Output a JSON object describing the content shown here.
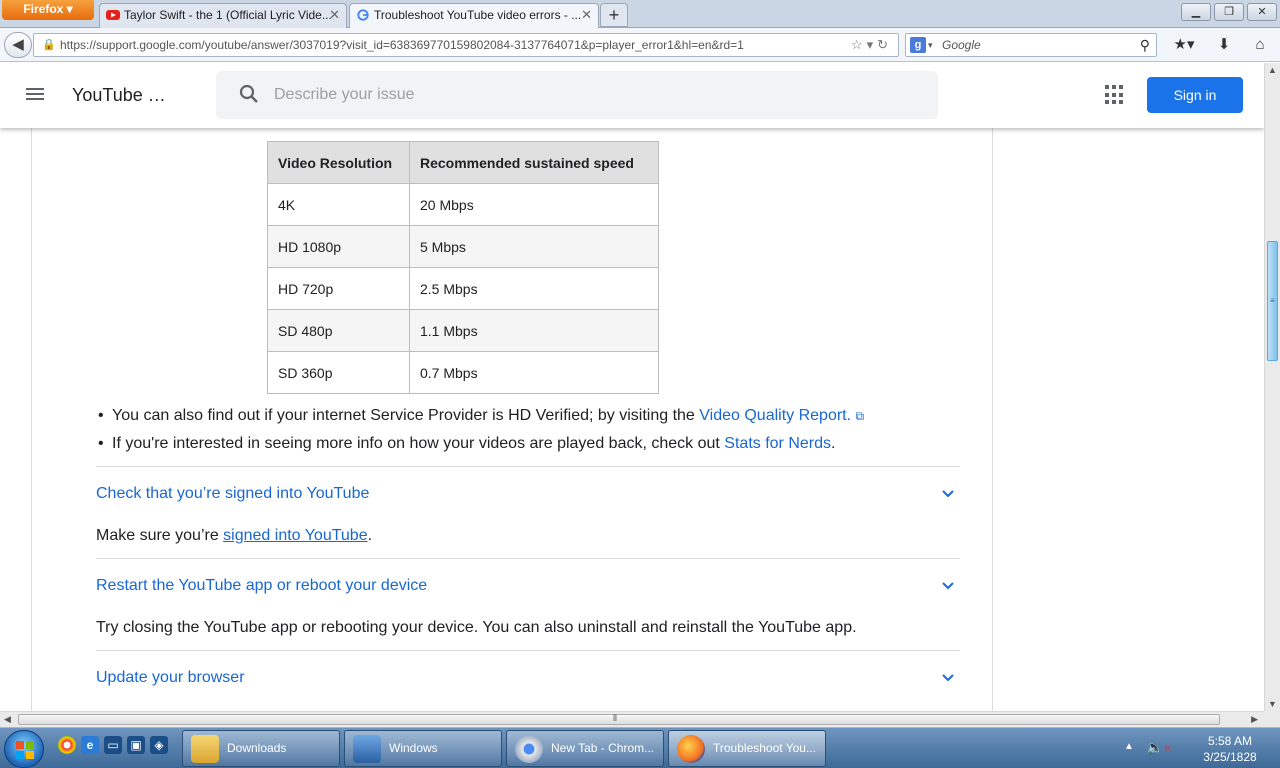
{
  "browser": {
    "menu_label": "Firefox",
    "tabs": [
      {
        "title": "Taylor Swift - the 1 (Official Lyric Vide...",
        "icon": "youtube-icon"
      },
      {
        "title": "Troubleshoot YouTube video errors - ...",
        "icon": "google-g-icon",
        "active": true
      }
    ],
    "new_tab_label": "+",
    "url": "https://support.google.com/youtube/answer/3037019?visit_id=638369770159802084-3137764071&p=player_error1&hl=en&rd=1",
    "search_placeholder": "Google"
  },
  "header": {
    "site_title": "YouTube …",
    "search_placeholder": "Describe your issue",
    "signin_label": "Sign in"
  },
  "speed_table": {
    "headers": [
      "Video Resolution",
      "Recommended sustained speed"
    ],
    "rows": [
      [
        "4K",
        "20 Mbps"
      ],
      [
        "HD 1080p",
        "5 Mbps"
      ],
      [
        "HD 720p",
        "2.5 Mbps"
      ],
      [
        "SD 480p",
        "1.1 Mbps"
      ],
      [
        "SD 360p",
        "0.7 Mbps"
      ]
    ]
  },
  "bullets": [
    {
      "text": "You can also find out if your internet Service Provider is HD Verified; by visiting the ",
      "link": "Video Quality Report.",
      "suffix": ""
    },
    {
      "text": "If you're interested in seeing more info on how your videos are played back, check out ",
      "link": "Stats for Nerds",
      "suffix": "."
    }
  ],
  "accordion": [
    {
      "title": "Check that you’re signed into YouTube",
      "body_prefix": "Make sure you’re ",
      "body_link": "signed into YouTube",
      "body_suffix": "."
    },
    {
      "title": "Restart the YouTube app or reboot your device",
      "body_prefix": "Try closing the YouTube app or rebooting your device. You can also uninstall and reinstall the YouTube app."
    },
    {
      "title": "Update your browser"
    }
  ],
  "taskbar": {
    "tasks": [
      {
        "label": "Downloads"
      },
      {
        "label": "Windows"
      },
      {
        "label": "New Tab - Chrom..."
      },
      {
        "label": "Troubleshoot You...",
        "active": true
      }
    ],
    "time": "5:58 AM",
    "date": "3/25/1828"
  },
  "colors": {
    "link": "#1967d2",
    "signin_bg": "#1a73e8",
    "firefox_orange": "#e76b0e"
  }
}
